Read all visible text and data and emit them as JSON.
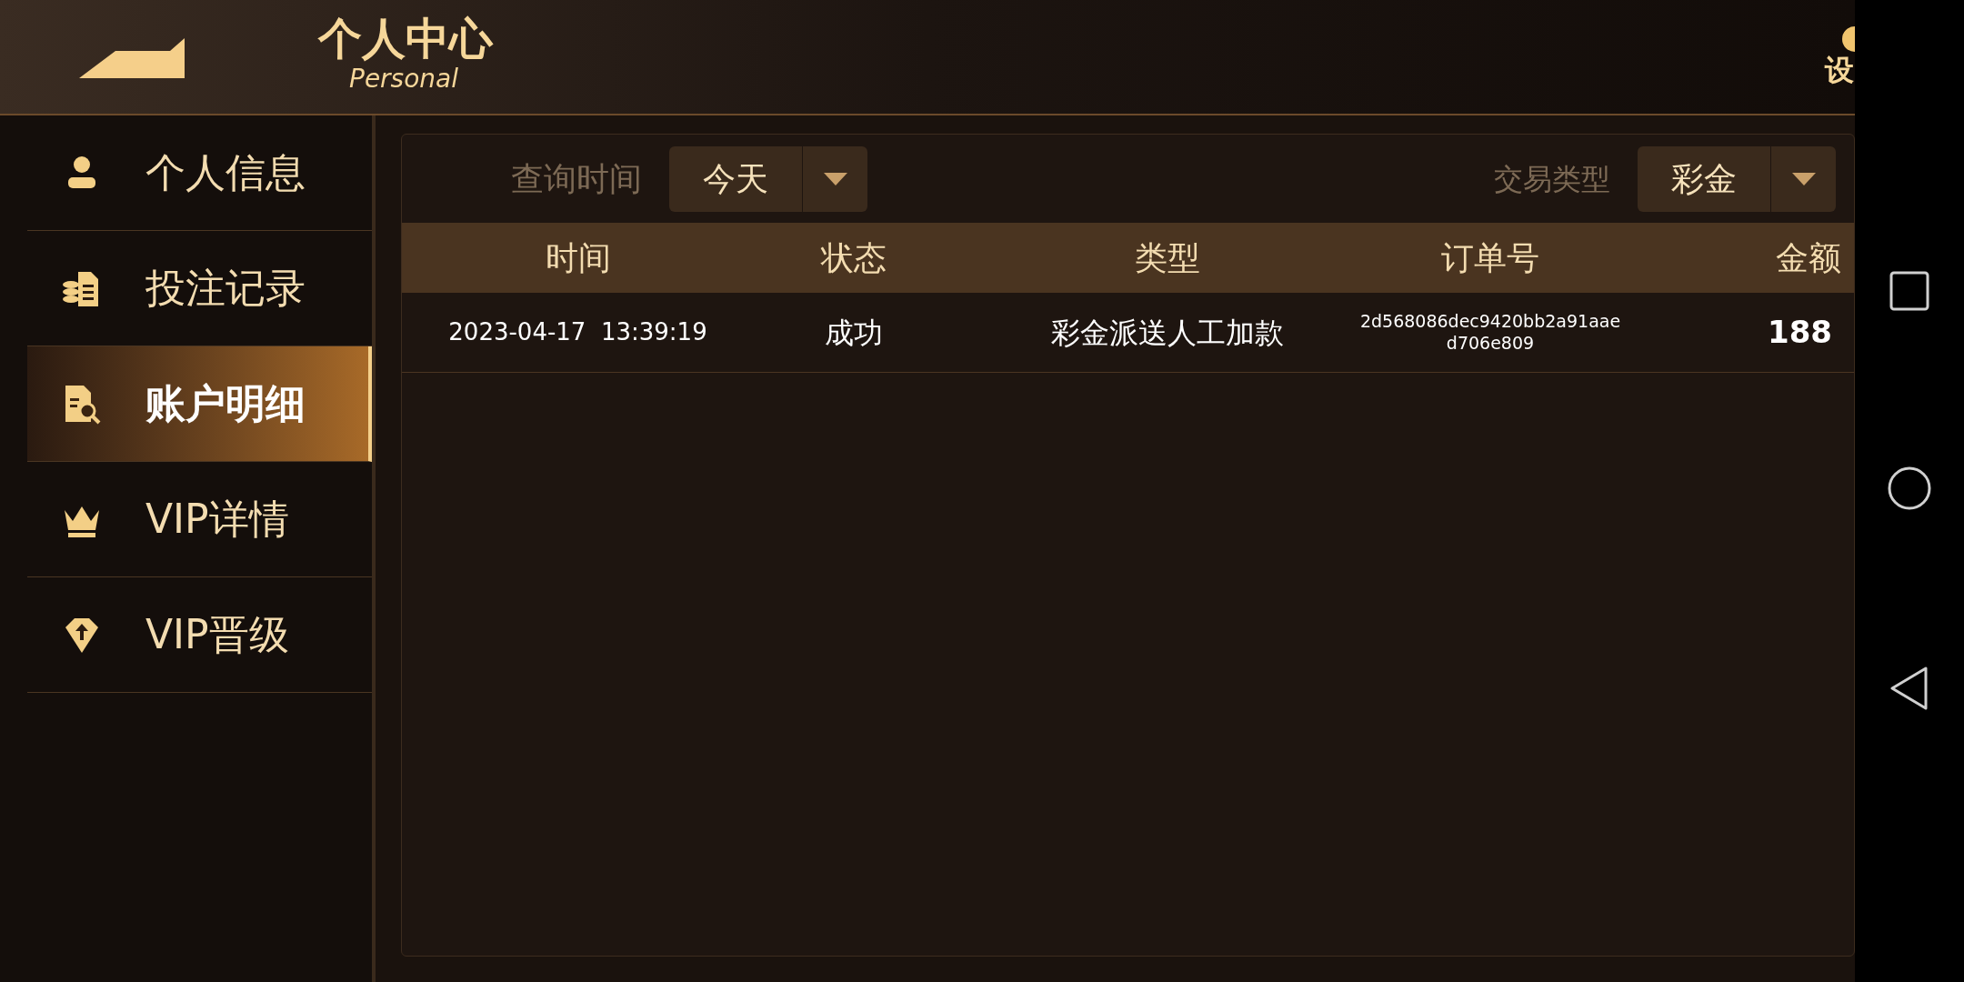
{
  "header": {
    "title": "个人中心",
    "subtitle": "Personal",
    "settings_label": "设"
  },
  "sidebar": {
    "items": [
      {
        "label": "个人信息",
        "selected": false
      },
      {
        "label": "投注记录",
        "selected": false
      },
      {
        "label": "账户明细",
        "selected": true
      },
      {
        "label": "VIP详情",
        "selected": false
      },
      {
        "label": "VIP晋级",
        "selected": false
      }
    ]
  },
  "filters": [
    {
      "label": "查询时间",
      "value": "今天"
    },
    {
      "label": "交易类型",
      "value": "彩金"
    }
  ],
  "table": {
    "columns": [
      "时间",
      "状态",
      "类型",
      "订单号",
      "金额"
    ],
    "rows": [
      {
        "time": "2023-04-17  13:39:19",
        "status": "成功",
        "type": "彩金派送人工加款",
        "order": [
          "2d568086dec9420bb2a91aae",
          "d706e809"
        ],
        "amount": "188"
      }
    ]
  }
}
